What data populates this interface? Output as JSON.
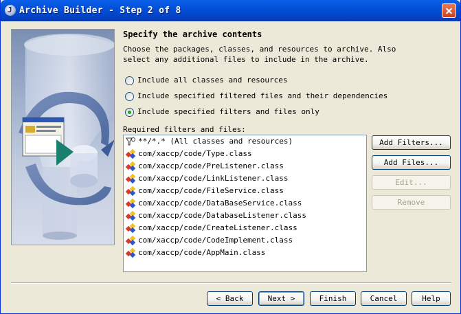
{
  "window": {
    "title": "Archive Builder - Step 2 of 8",
    "app_icon_glyph": "J"
  },
  "page": {
    "heading": "Specify the archive contents",
    "description": "Choose the packages, classes, and resources to archive. Also select any additional files to include in the archive."
  },
  "options": [
    {
      "label": "Include all classes and resources",
      "checked": false
    },
    {
      "label": "Include specified filtered files and their dependencies",
      "checked": false
    },
    {
      "label": "Include specified filters and files only",
      "checked": true
    }
  ],
  "list": {
    "label": "Required filters and files:",
    "items": [
      {
        "text": "**/*.* (All classes and resources)",
        "icon": "filter-icon"
      },
      {
        "text": "com/xaccp/code/Type.class",
        "icon": "class-file-icon"
      },
      {
        "text": "com/xaccp/code/PreListener.class",
        "icon": "class-file-icon"
      },
      {
        "text": "com/xaccp/code/LinkListener.class",
        "icon": "class-file-icon"
      },
      {
        "text": "com/xaccp/code/FileService.class",
        "icon": "class-file-icon"
      },
      {
        "text": "com/xaccp/code/DataBaseService.class",
        "icon": "class-file-icon"
      },
      {
        "text": "com/xaccp/code/DatabaseListener.class",
        "icon": "class-file-icon"
      },
      {
        "text": "com/xaccp/code/CreateListener.class",
        "icon": "class-file-icon"
      },
      {
        "text": "com/xaccp/code/CodeImplement.class",
        "icon": "class-file-icon"
      },
      {
        "text": "com/xaccp/code/AppMain.class",
        "icon": "class-file-icon"
      }
    ]
  },
  "side_buttons": {
    "add_filters": "Add Filters...",
    "add_files": "Add Files...",
    "edit": "Edit...",
    "remove": "Remove"
  },
  "nav_buttons": {
    "back": "< Back",
    "next": "Next >",
    "finish": "Finish",
    "cancel": "Cancel",
    "help": "Help"
  },
  "colors": {
    "titlebar": "#0350d8",
    "dialog_bg": "#ece9d8",
    "radio_checked": "#21a121"
  }
}
